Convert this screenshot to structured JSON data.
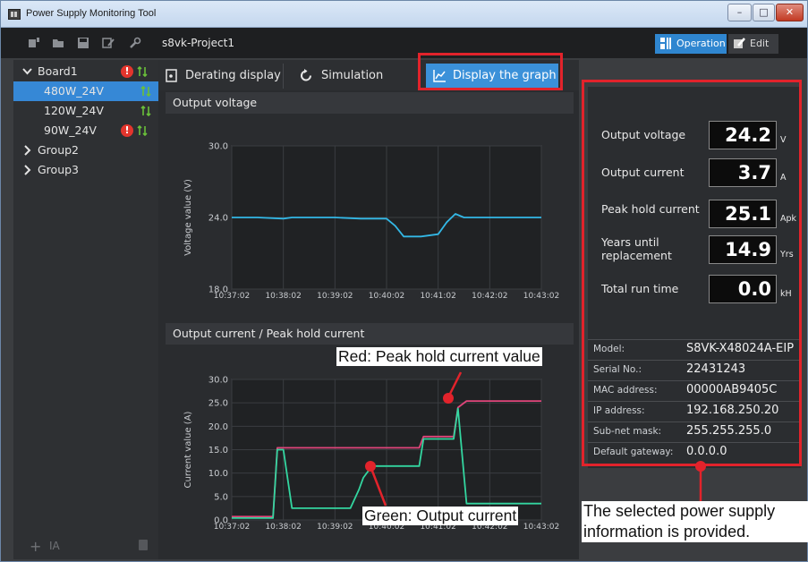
{
  "window": {
    "title": "Power Supply Monitoring Tool",
    "min": "–",
    "max": "□",
    "close": "✕"
  },
  "toolbar": {
    "project": "s8vk-Project1",
    "operation_label": "Operation",
    "edit_label": "Edit",
    "icons": [
      "device-icon",
      "folder-icon",
      "save-icon",
      "settings-edit-icon",
      "wrench-icon"
    ]
  },
  "tree": {
    "items": [
      {
        "label": "Board1",
        "expanded": true,
        "alert": "!",
        "status_icon": "updown-arrows-icon"
      },
      {
        "label": "480W_24V",
        "selected": true,
        "status_icon": "updown-arrows-icon"
      },
      {
        "label": "120W_24V",
        "status_icon": "updown-arrows-icon"
      },
      {
        "label": "90W_24V",
        "alert": "!",
        "status_icon": "updown-arrows-icon"
      },
      {
        "label": "Group2",
        "expanded": false
      },
      {
        "label": "Group3",
        "expanded": false
      }
    ],
    "footer": {
      "add": "+",
      "rename": "IA"
    }
  },
  "tabs": [
    {
      "label": "Derating display",
      "icon": "derating-icon"
    },
    {
      "label": "Simulation",
      "icon": "refresh-icon"
    },
    {
      "label": "Display the graph",
      "icon": "line-graph-icon",
      "active": true
    }
  ],
  "charts": {
    "voltage": {
      "title": "Output voltage",
      "ylabel": "Voltage value (V)",
      "yticks": [
        "30.0",
        "24.0",
        "18.0"
      ],
      "xticks": [
        "10:37:02",
        "10:38:02",
        "10:39:02",
        "10:40:02",
        "10:41:02",
        "10:42:02",
        "10:43:02"
      ]
    },
    "current": {
      "title": "Output current / Peak hold current",
      "ylabel": "Current value (A)",
      "yticks": [
        "30.0",
        "25.0",
        "20.0",
        "15.0",
        "10.0",
        "5.0",
        "0.0"
      ],
      "xticks": [
        "10:37:02",
        "10:38:02",
        "10:39:02",
        "10:40:02",
        "10:41:02",
        "10:42:02",
        "10:43:02"
      ]
    }
  },
  "chart_data": [
    {
      "type": "line",
      "title": "Output voltage",
      "xlabel": "",
      "ylabel": "Voltage value (V)",
      "ylim": [
        18,
        30
      ],
      "x": [
        "10:37:02",
        "10:37:32",
        "10:38:02",
        "10:38:12",
        "10:38:32",
        "10:39:02",
        "10:39:32",
        "10:40:02",
        "10:40:12",
        "10:40:22",
        "10:40:32",
        "10:40:42",
        "10:41:02",
        "10:41:12",
        "10:41:22",
        "10:41:32",
        "10:41:42",
        "10:42:02",
        "10:42:32",
        "10:43:02"
      ],
      "series": [
        {
          "name": "",
          "color": "#33b8e6",
          "values": [
            24.0,
            24.0,
            23.9,
            24.0,
            24.0,
            24.0,
            23.9,
            23.9,
            23.3,
            22.4,
            22.4,
            22.4,
            22.6,
            23.6,
            24.3,
            24.0,
            24.0,
            24.0,
            24.0,
            24.0
          ]
        }
      ]
    },
    {
      "type": "line",
      "title": "Output current / Peak hold current",
      "xlabel": "",
      "ylabel": "Current value (A)",
      "ylim": [
        0,
        30
      ],
      "x": [
        "10:37:02",
        "10:37:50",
        "10:37:55",
        "10:38:02",
        "10:38:12",
        "10:38:15",
        "10:39:02",
        "10:39:20",
        "10:39:30",
        "10:39:35",
        "10:39:45",
        "10:40:02",
        "10:40:40",
        "10:40:45",
        "10:41:02",
        "10:41:20",
        "10:41:25",
        "10:41:35",
        "10:42:02",
        "10:43:02"
      ],
      "series": [
        {
          "name": "Peak hold current value",
          "color": "#e0457a",
          "values": [
            0.7,
            0.7,
            15.4,
            15.4,
            15.4,
            15.4,
            15.4,
            15.4,
            15.4,
            15.4,
            15.4,
            15.4,
            15.4,
            17.8,
            17.8,
            17.8,
            24.0,
            25.4,
            25.4,
            25.4
          ]
        },
        {
          "name": "Output current",
          "color": "#33d6a0",
          "values": [
            0.4,
            0.4,
            15.0,
            15.0,
            2.5,
            2.5,
            2.5,
            2.5,
            6.5,
            9.0,
            11.5,
            11.5,
            11.5,
            17.3,
            17.3,
            17.3,
            23.8,
            3.5,
            3.5,
            3.5
          ]
        }
      ]
    }
  ],
  "status": {
    "values": [
      {
        "label": "Output voltage",
        "value": "24.2",
        "unit": "V"
      },
      {
        "label": "Output current",
        "value": "3.7",
        "unit": "A"
      },
      {
        "label": "Peak hold current",
        "value": "25.1",
        "unit": "Apk"
      },
      {
        "label": "Years until replacement",
        "value": "14.9",
        "unit": "Yrs"
      },
      {
        "label": "Total run time",
        "value": "0.0",
        "unit": "kH"
      }
    ],
    "info": [
      {
        "key": "Model:",
        "value": "S8VK-X48024A-EIP"
      },
      {
        "key": "Serial No.:",
        "value": "22431243"
      },
      {
        "key": "MAC address:",
        "value": "00000AB9405C"
      },
      {
        "key": "IP address:",
        "value": "192.168.250.20"
      },
      {
        "key": "Sub-net mask:",
        "value": "255.255.255.0"
      },
      {
        "key": "Default gateway:",
        "value": "0.0.0.0"
      }
    ]
  },
  "annotations": {
    "peak": "Red: Peak hold current value",
    "output": "Green: Output current",
    "info": "The selected power supply information is provided.",
    "color": "#e2232b"
  }
}
